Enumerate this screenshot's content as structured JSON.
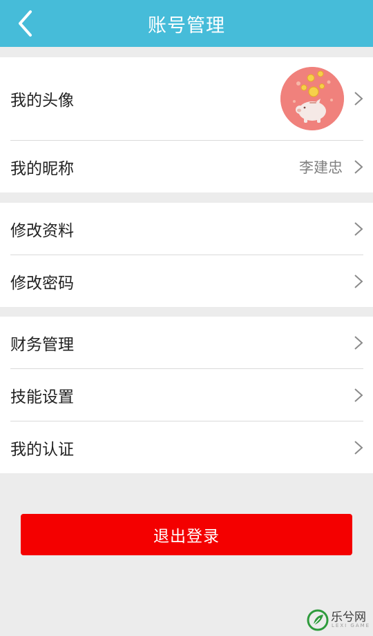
{
  "header": {
    "title": "账号管理",
    "back_icon": "chevron-left-icon",
    "bg_color": "#46bcd9"
  },
  "groups": [
    {
      "rows": [
        {
          "label": "我的头像",
          "type": "avatar",
          "avatar_icon": "piggy-bank-coins-avatar"
        },
        {
          "label": "我的昵称",
          "value": "李建忠"
        }
      ]
    },
    {
      "rows": [
        {
          "label": "修改资料"
        },
        {
          "label": "修改密码"
        }
      ]
    },
    {
      "rows": [
        {
          "label": "财务管理"
        },
        {
          "label": "技能设置"
        },
        {
          "label": "我的认证"
        }
      ]
    }
  ],
  "logout": {
    "label": "退出登录",
    "color": "#f40000"
  },
  "watermark": {
    "text": "乐兮网",
    "sub": "LEXI GAME"
  }
}
